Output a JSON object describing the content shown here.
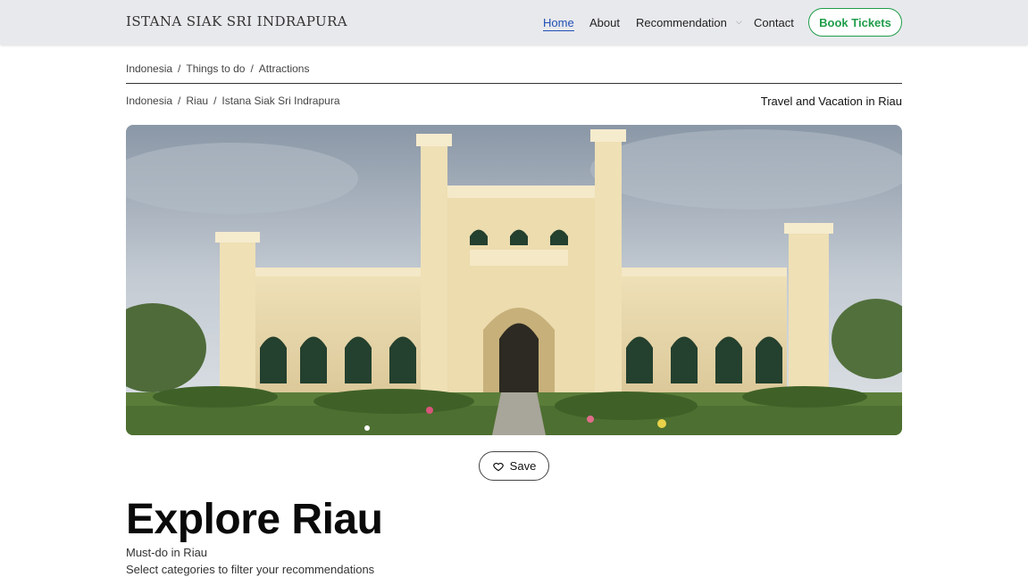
{
  "navbar": {
    "brand": "ISTANA SIAK SRI INDRAPURA",
    "links": {
      "home": "Home",
      "about": "About",
      "recommendation": "Recommendation",
      "contact": "Contact"
    },
    "book_button": "Book Tickets"
  },
  "breadcrumb_top": {
    "items": [
      "Indonesia",
      "Things to do",
      "Attractions"
    ]
  },
  "breadcrumb_location": {
    "items": [
      "Indonesia",
      "Riau",
      "Istana Siak Sri Indrapura"
    ]
  },
  "travel_text": "Travel and Vacation in Riau",
  "hero": {
    "icon": "palace-photo"
  },
  "save_button": "Save",
  "heading": {
    "title": "Explore Riau",
    "subtitle": "Must-do in Riau",
    "filter_hint": "Select categories to filter your recommendations"
  },
  "colors": {
    "accent_blue": "#1f4fb5",
    "brand_green": "#1f9d4a",
    "navbar_bg": "#e8e9ec"
  }
}
